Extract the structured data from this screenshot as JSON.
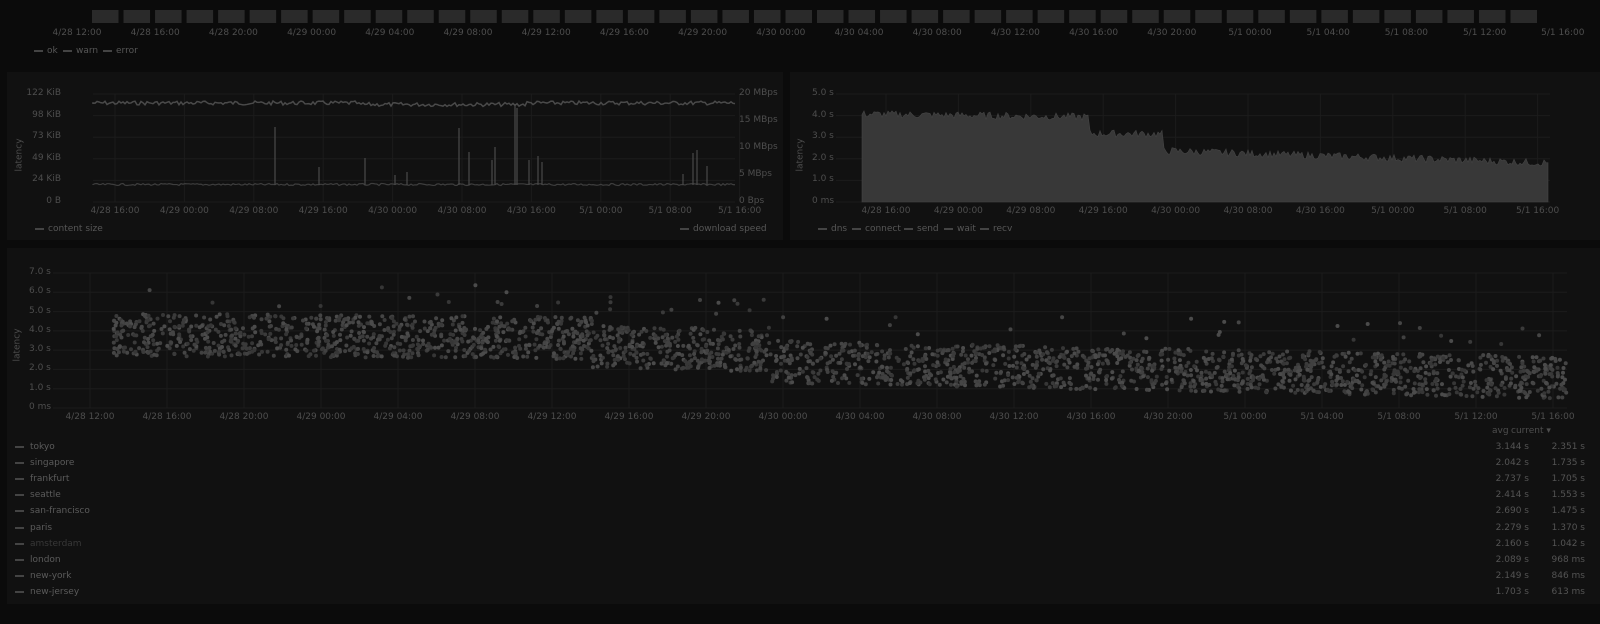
{
  "status_panel": {
    "x_ticks": [
      "4/28 12:00",
      "4/28 16:00",
      "4/28 20:00",
      "4/29 00:00",
      "4/29 04:00",
      "4/29 08:00",
      "4/29 12:00",
      "4/29 16:00",
      "4/29 20:00",
      "4/30 00:00",
      "4/30 04:00",
      "4/30 08:00",
      "4/30 12:00",
      "4/30 16:00",
      "4/30 20:00",
      "5/1 00:00",
      "5/1 04:00",
      "5/1 08:00",
      "5/1 12:00",
      "5/1 16:00"
    ],
    "legend": [
      "ok",
      "warn",
      "error"
    ],
    "bar_count": 46
  },
  "size_panel": {
    "ylabel": "latency",
    "y_left_ticks": [
      "122 KiB",
      "98 KiB",
      "73 KiB",
      "49 KiB",
      "24 KiB",
      "0 B"
    ],
    "y_right_ticks": [
      "20 MBps",
      "15 MBps",
      "10 MBps",
      "5 MBps",
      "0 Bps"
    ],
    "x_ticks": [
      "4/28 16:00",
      "4/29 00:00",
      "4/29 08:00",
      "4/29 16:00",
      "4/30 00:00",
      "4/30 08:00",
      "4/30 16:00",
      "5/1 00:00",
      "5/1 08:00",
      "5/1 16:00"
    ],
    "legend_left": "content size",
    "legend_right": "download speed"
  },
  "timing_panel": {
    "ylabel": "latency",
    "y_ticks": [
      "5.0 s",
      "4.0 s",
      "3.0 s",
      "2.0 s",
      "1.0 s",
      "0 ms"
    ],
    "x_ticks": [
      "4/28 16:00",
      "4/29 00:00",
      "4/29 08:00",
      "4/29 16:00",
      "4/30 00:00",
      "4/30 08:00",
      "4/30 16:00",
      "5/1 00:00",
      "5/1 08:00",
      "5/1 16:00"
    ],
    "legend": [
      "dns",
      "connect",
      "send",
      "wait",
      "recv"
    ]
  },
  "scatter_panel": {
    "ylabel": "latency",
    "y_ticks": [
      "7.0 s",
      "6.0 s",
      "5.0 s",
      "4.0 s",
      "3.0 s",
      "2.0 s",
      "1.0 s",
      "0 ms"
    ],
    "x_ticks": [
      "4/28 12:00",
      "4/28 16:00",
      "4/28 20:00",
      "4/29 00:00",
      "4/29 04:00",
      "4/29 08:00",
      "4/29 12:00",
      "4/29 16:00",
      "4/29 20:00",
      "4/30 00:00",
      "4/30 04:00",
      "4/30 08:00",
      "4/30 12:00",
      "4/30 16:00",
      "4/30 20:00",
      "5/1 00:00",
      "5/1 04:00",
      "5/1 08:00",
      "5/1 12:00",
      "5/1 16:00"
    ],
    "col_avg": "avg",
    "col_current": "current ▾",
    "rows": [
      {
        "name": "tokyo",
        "avg": "3.144 s",
        "current": "2.351 s",
        "dim": false
      },
      {
        "name": "singapore",
        "avg": "2.042 s",
        "current": "1.735 s",
        "dim": false
      },
      {
        "name": "frankfurt",
        "avg": "2.737 s",
        "current": "1.705 s",
        "dim": false
      },
      {
        "name": "seattle",
        "avg": "2.414 s",
        "current": "1.553 s",
        "dim": false
      },
      {
        "name": "san-francisco",
        "avg": "2.690 s",
        "current": "1.475 s",
        "dim": false
      },
      {
        "name": "paris",
        "avg": "2.279 s",
        "current": "1.370 s",
        "dim": false
      },
      {
        "name": "amsterdam",
        "avg": "2.160 s",
        "current": "1.042 s",
        "dim": true
      },
      {
        "name": "london",
        "avg": "2.089 s",
        "current": "968 ms",
        "dim": false
      },
      {
        "name": "new-york",
        "avg": "2.149 s",
        "current": "846 ms",
        "dim": false
      },
      {
        "name": "new-jersey",
        "avg": "1.703 s",
        "current": "613 ms",
        "dim": false
      }
    ]
  },
  "colors": {
    "bg": "#0b0b0b",
    "panel": "#111111",
    "grid": "#1e1e1e",
    "text": "#4e4e4e",
    "series": "#444444"
  }
}
